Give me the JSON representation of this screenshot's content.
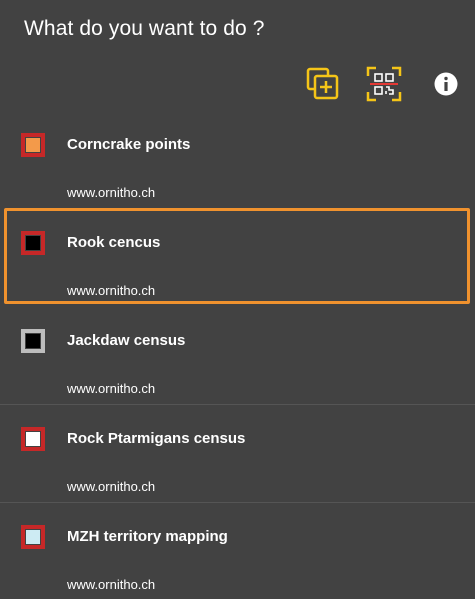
{
  "header": {
    "title": "What do you want to do ?"
  },
  "toolbar": {
    "add_icon": "add-copy-icon",
    "qr_icon": "qr-scan-icon",
    "info_icon": "info-icon",
    "accent": "#f5c518"
  },
  "items": [
    {
      "title": "Corncrake points",
      "subtitle": "www.ornitho.ch",
      "border": "#c62828",
      "fill": "#f39a4a"
    },
    {
      "title": "Rook cencus",
      "subtitle": "www.ornitho.ch",
      "border": "#c62828",
      "fill": "#000000"
    },
    {
      "title": "Jackdaw census",
      "subtitle": "www.ornitho.ch",
      "border": "#bdbdbd",
      "fill": "#000000"
    },
    {
      "title": "Rock Ptarmigans census",
      "subtitle": "www.ornitho.ch",
      "border": "#c62828",
      "fill": "#ffffff"
    },
    {
      "title": "MZH territory mapping",
      "subtitle": "www.ornitho.ch",
      "border": "#c62828",
      "fill": "#cdebf3"
    }
  ],
  "selected_index": 1,
  "highlight_color": "#f0922e"
}
